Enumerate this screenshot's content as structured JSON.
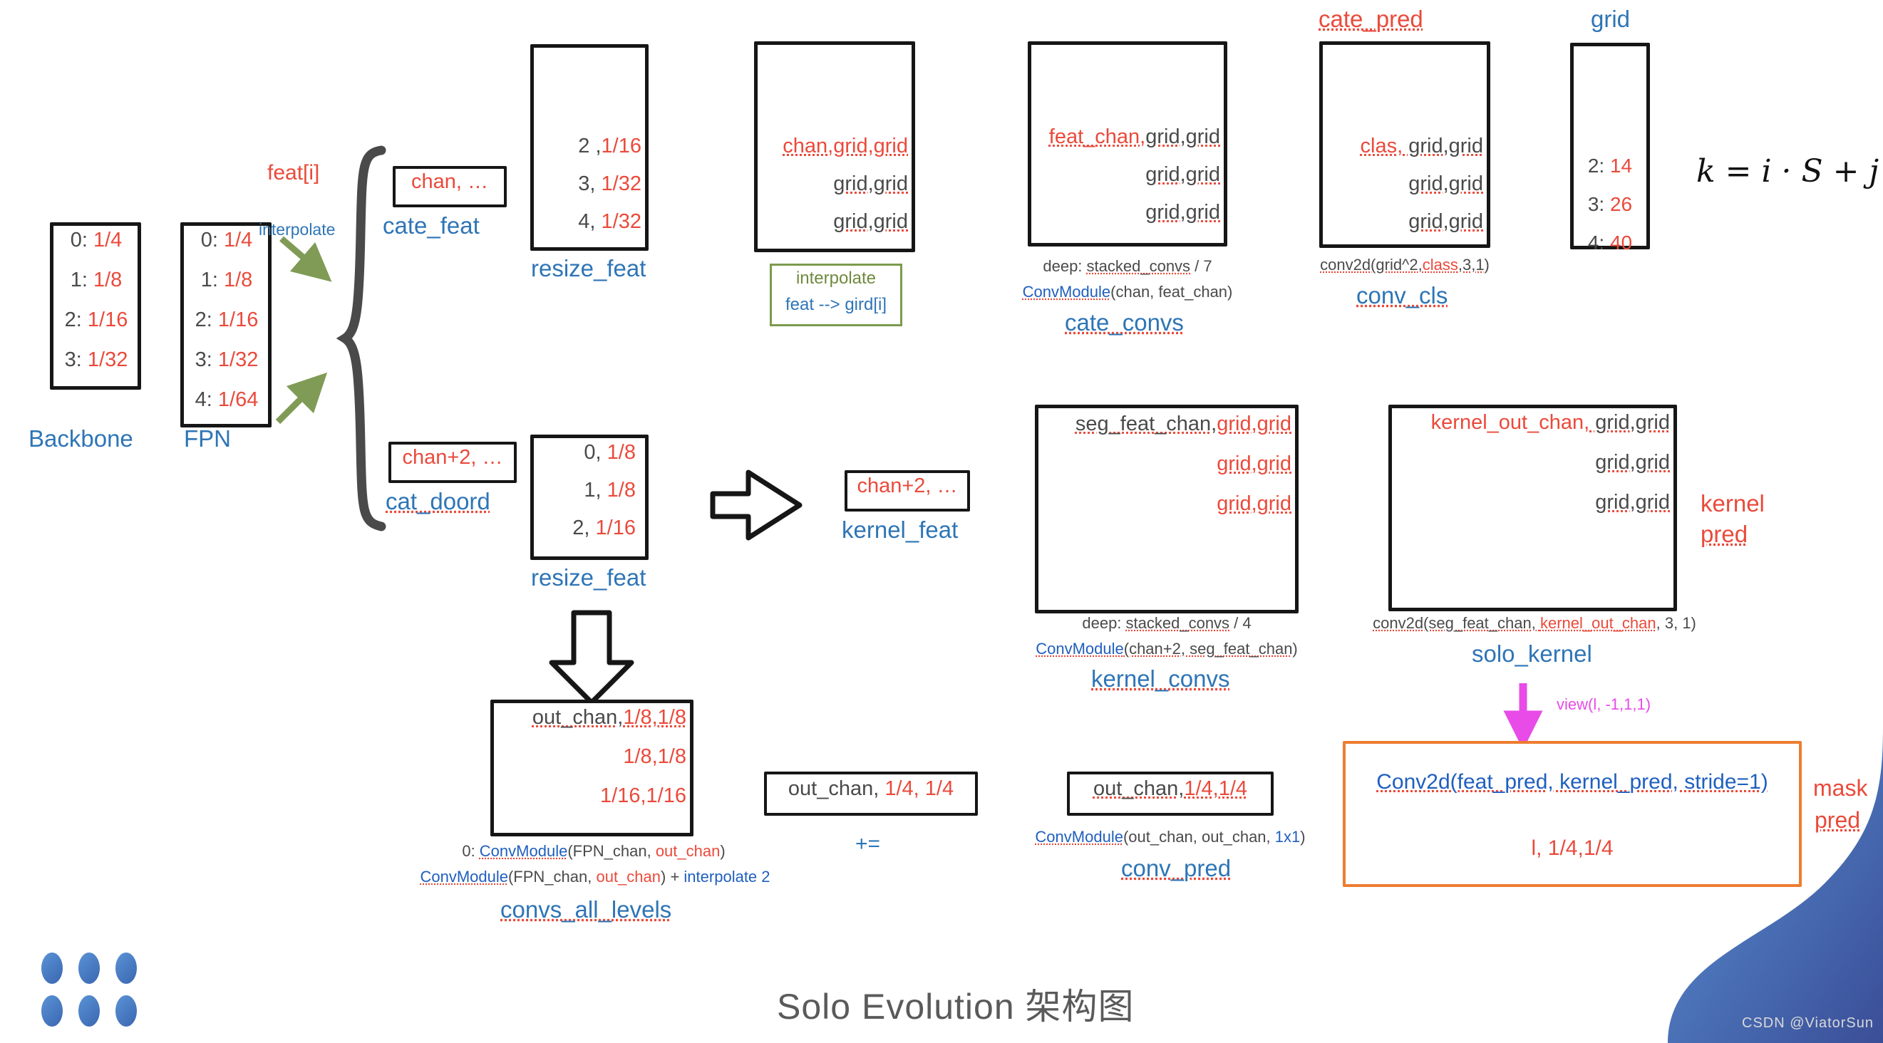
{
  "title": "Solo Evolution 架构图",
  "watermark": "CSDN @ViatorSun",
  "formula": "k = i · S + j",
  "colors": {
    "red": "#EA4A3B",
    "blue": "#2E75B6",
    "green": "#70893F",
    "magenta": "#E84BE8",
    "orange": "#ED7D31",
    "gray": "#4A4A4A"
  },
  "backbone": {
    "caption": "Backbone",
    "rows": [
      {
        "idx": "0:",
        "val": "1/4"
      },
      {
        "idx": "1:",
        "val": "1/8"
      },
      {
        "idx": "2:",
        "val": "1/16"
      },
      {
        "idx": "3:",
        "val": "1/32"
      }
    ]
  },
  "fpn": {
    "caption": "FPN",
    "rows": [
      {
        "idx": "0:",
        "val": "1/4"
      },
      {
        "idx": "1:",
        "val": "1/8"
      },
      {
        "idx": "2:",
        "val": "1/16"
      },
      {
        "idx": "3:",
        "val": "1/32"
      },
      {
        "idx": "4:",
        "val": "1/64"
      }
    ]
  },
  "feat_label": "feat[i]",
  "interpolate_label": "interpolate",
  "cate_feat": {
    "caption": "cate_feat",
    "value": "chan, …"
  },
  "cat_doord": {
    "caption": "cat_doord",
    "value": "chan+2, …"
  },
  "resize_feat_top": {
    "caption": "resize_feat",
    "rows": [
      {
        "idx": "2 ,",
        "val": "1/16"
      },
      {
        "idx": "3,",
        "val": "1/32"
      },
      {
        "idx": "4,",
        "val": "1/32"
      }
    ]
  },
  "resize_feat_bottom": {
    "caption": "resize_feat",
    "rows": [
      {
        "idx": "0,",
        "val": "1/8"
      },
      {
        "idx": "1,",
        "val": "1/8"
      },
      {
        "idx": "2,",
        "val": "1/16"
      }
    ]
  },
  "grid_interp_box": {
    "rows": [
      "chan,grid,grid",
      "grid,grid",
      "grid,grid"
    ],
    "note_line1": "interpolate",
    "note_line2": "feat --> gird[i]"
  },
  "cate_convs": {
    "caption": "cate_convs",
    "row_head_red": "feat_chan,",
    "row_head_gray": "grid,grid",
    "rows": [
      "grid,grid",
      "grid,grid"
    ],
    "note1_a": "deep: ",
    "note1_b": "stacked_convs",
    "note1_c": " / 7",
    "note2_a": "ConvModule",
    "note2_b": "(chan, feat_chan)"
  },
  "conv_cls": {
    "top_label": "cate_pred",
    "caption": "conv_cls",
    "row_head_red": "clas,",
    "row_head_gray": " grid,grid",
    "rows": [
      "grid,grid",
      "grid,grid"
    ],
    "note_a": "conv2d(grid^2,",
    "note_b": "class",
    "note_c": ",3,1)"
  },
  "grid_box": {
    "caption": "grid",
    "rows": [
      {
        "idx": "2:",
        "val": "14"
      },
      {
        "idx": "3:",
        "val": "26"
      },
      {
        "idx": "4:",
        "val": "40"
      }
    ]
  },
  "kernel_feat": {
    "caption": "kernel_feat",
    "value": "chan+2, …"
  },
  "kernel_convs": {
    "caption": "kernel_convs",
    "row_head_gray": "seg_feat_chan,",
    "row_head_red": "grid,grid",
    "rows": [
      "grid,grid",
      "grid,grid"
    ],
    "note1_a": "deep: ",
    "note1_b": "stacked_convs",
    "note1_c": " / 4",
    "note2_a": "ConvModule",
    "note2_b": "(chan+2, seg_feat_chan)"
  },
  "solo_kernel": {
    "caption": "solo_kernel",
    "row_head_red": "kernel_out_chan,",
    "row_head_gray": " grid,grid",
    "rows": [
      "grid,grid",
      "grid,grid"
    ],
    "side_label_line1": "kernel",
    "side_label_line2": "pred",
    "note_a": "conv2d(seg_feat_chan, ",
    "note_b": "kernel_out_chan",
    "note_c": ", 3, 1)"
  },
  "view_label": "view(l, -1,1,1)",
  "convs_all_levels": {
    "caption": "convs_all_levels",
    "row_head_gray": "out_chan,",
    "row_head_red": "1/8,1/8",
    "rows": [
      "1/8,1/8",
      "1/16,1/16"
    ],
    "note1_a": "0: ",
    "note1_b": "ConvModule",
    "note1_c": "(FPN_chan, ",
    "note1_d": "out_chan",
    "note1_e": ")",
    "note2_a": "ConvModule",
    "note2_b": "(FPN_chan, ",
    "note2_c": "out_chan",
    "note2_d": ") + ",
    "note2_e": "interpolate 2"
  },
  "plus_equal": {
    "caption": "+=",
    "value_gray": "out_chan, ",
    "value_red": "1/4, 1/4"
  },
  "conv_pred": {
    "caption": "conv_pred",
    "value_gray": "out_chan,",
    "value_red": "1/4,1/4",
    "note_a": "ConvModule",
    "note_b": "(out_chan, out_chan, ",
    "note_c": "1x1",
    "note_d": ")"
  },
  "mask_pred": {
    "line1": "Conv2d(feat_pred, kernel_pred, stride=1)",
    "line2": "l, 1/4,1/4",
    "side_label_line1": "mask",
    "side_label_line2": "pred"
  }
}
